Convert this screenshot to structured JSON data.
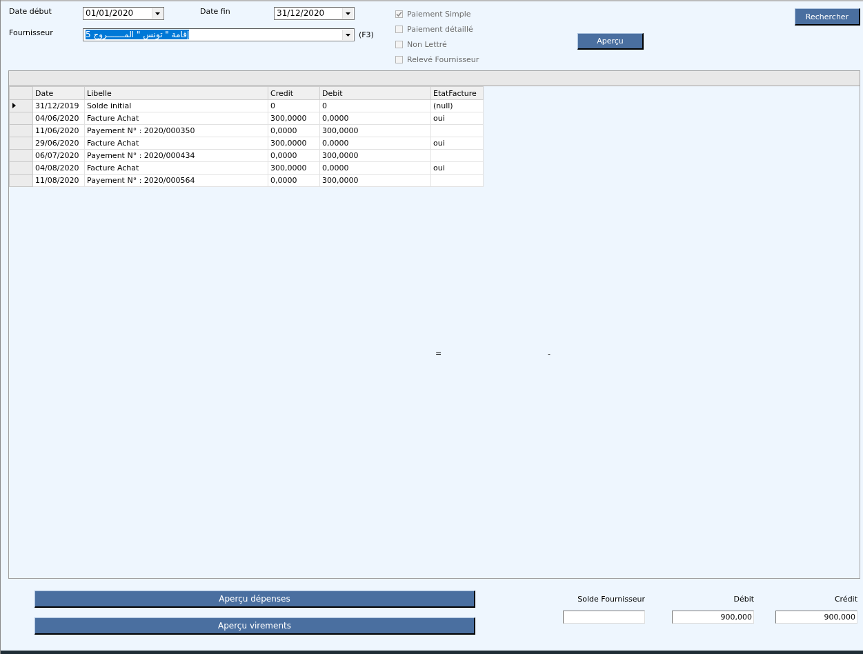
{
  "filters": {
    "date_start": {
      "label": "Date début",
      "value": "01/01/2020"
    },
    "date_end": {
      "label": "Date fin",
      "value": "31/12/2020"
    },
    "supplier": {
      "label": "Fournisseur",
      "value": "إقامة \" تونس \" المـــــــروج 5",
      "text_selected": true,
      "shortcut": "(F3)"
    }
  },
  "options": [
    {
      "label": "Paiement Simple",
      "checked": true,
      "disabled": true
    },
    {
      "label": "Paiement détaillé",
      "checked": false,
      "disabled": true
    },
    {
      "label": "Non Lettré",
      "checked": false,
      "disabled": true
    },
    {
      "label": "Relevé Fournisseur",
      "checked": false,
      "disabled": true
    }
  ],
  "search_button": "Rechercher",
  "preview_button": "Aperçu",
  "table": {
    "columns": [
      "Date",
      "Libelle",
      "Credit",
      "Debit",
      "EtatFacture"
    ],
    "rows": [
      {
        "current": true,
        "cells": [
          "31/12/2019",
          "Solde initial",
          "0",
          "0",
          "(null)"
        ]
      },
      {
        "current": false,
        "cells": [
          "04/06/2020",
          "Facture  Achat",
          "300,0000",
          "0,0000",
          "oui"
        ]
      },
      {
        "current": false,
        "cells": [
          "11/06/2020",
          "Payement N° : 2020/000350",
          "0,0000",
          "300,0000",
          ""
        ]
      },
      {
        "current": false,
        "cells": [
          "29/06/2020",
          "Facture  Achat",
          "300,0000",
          "0,0000",
          "oui"
        ]
      },
      {
        "current": false,
        "cells": [
          "06/07/2020",
          "Payement N° : 2020/000434",
          "0,0000",
          "300,0000",
          ""
        ]
      },
      {
        "current": false,
        "cells": [
          "04/08/2020",
          "Facture  Achat",
          "300,0000",
          "0,0000",
          "oui"
        ]
      },
      {
        "current": false,
        "cells": [
          "11/08/2020",
          "Payement N° : 2020/000564",
          "0,0000",
          "300,0000",
          ""
        ]
      }
    ]
  },
  "marks": [
    "=",
    "-"
  ],
  "bottom_buttons": [
    "Aperçu dépenses",
    "Aperçu virements"
  ],
  "totals": [
    {
      "label": "Solde Fournisseur"
    },
    {
      "label": "Débit",
      "value": "900,000"
    },
    {
      "label": "Crédit",
      "value": "900,000"
    }
  ]
}
